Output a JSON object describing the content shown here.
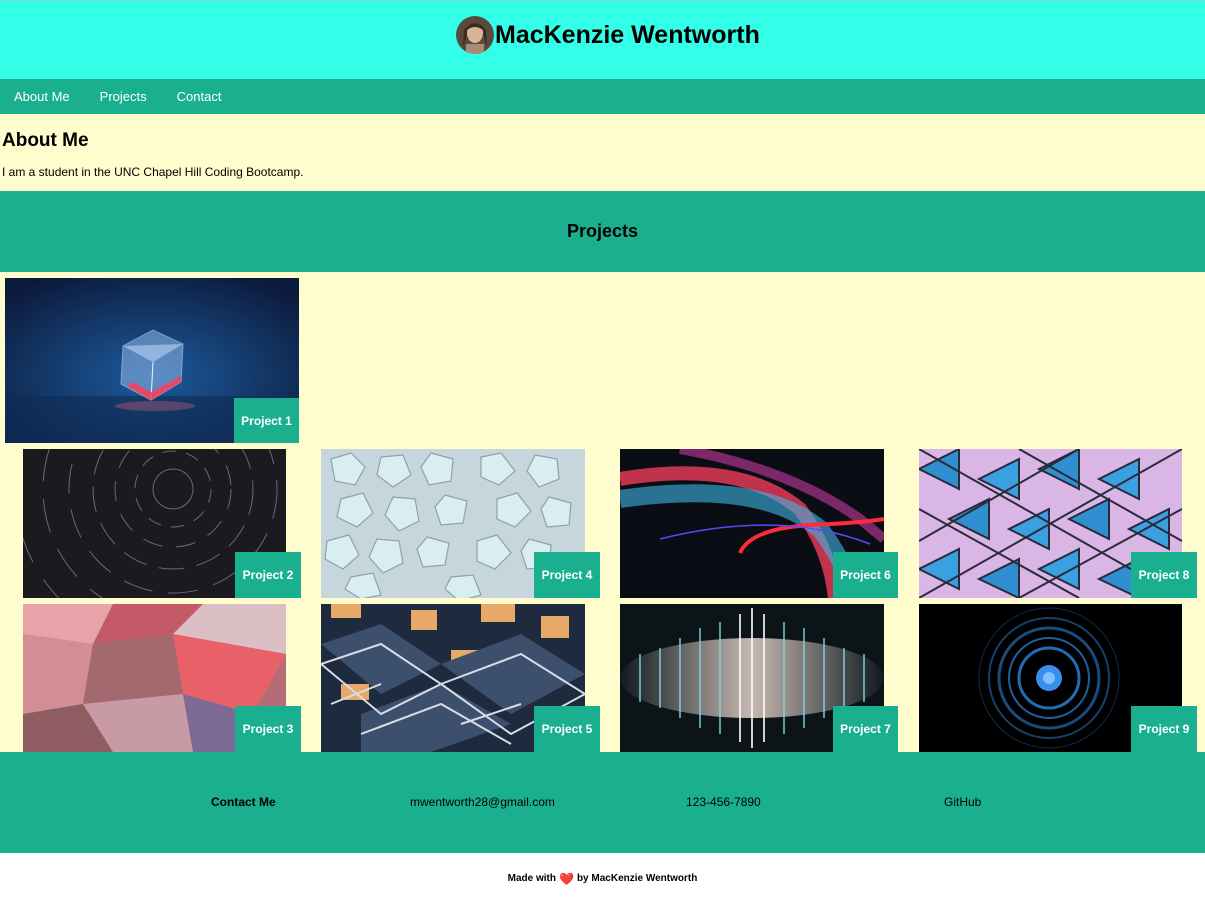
{
  "header": {
    "title": "MacKenzie Wentworth",
    "avatar_icon": "profile-photo"
  },
  "nav": {
    "items": [
      "About Me",
      "Projects",
      "Contact"
    ]
  },
  "about": {
    "heading": "About Me",
    "text": "I am a student in the UNC Chapel Hill Coding Bootcamp."
  },
  "projects": {
    "heading": "Projects",
    "cards": [
      {
        "label": "Project 1",
        "image": "glass-cube-on-blue"
      },
      {
        "label": "Project 2",
        "image": "star-trails"
      },
      {
        "label": "Project 4",
        "image": "pentagon-tiles"
      },
      {
        "label": "Project 6",
        "image": "light-streaks"
      },
      {
        "label": "Project 8",
        "image": "triangle-facade"
      },
      {
        "label": "Project 3",
        "image": "pink-polyhedra"
      },
      {
        "label": "Project 5",
        "image": "building-blocks"
      },
      {
        "label": "Project 7",
        "image": "sound-wave"
      },
      {
        "label": "Project 9",
        "image": "blue-rings"
      }
    ]
  },
  "footer": {
    "title": "Contact Me",
    "email": "mwentworth28@gmail.com",
    "phone": "123-456-7890",
    "github": "GitHub"
  },
  "credit": {
    "before": "Made with",
    "heart": "❤️",
    "after": "by MacKenzie Wentworth"
  },
  "colors": {
    "header_bg": "#33ffe8",
    "accent": "#1ab08f",
    "cream": "#fffdcd"
  }
}
